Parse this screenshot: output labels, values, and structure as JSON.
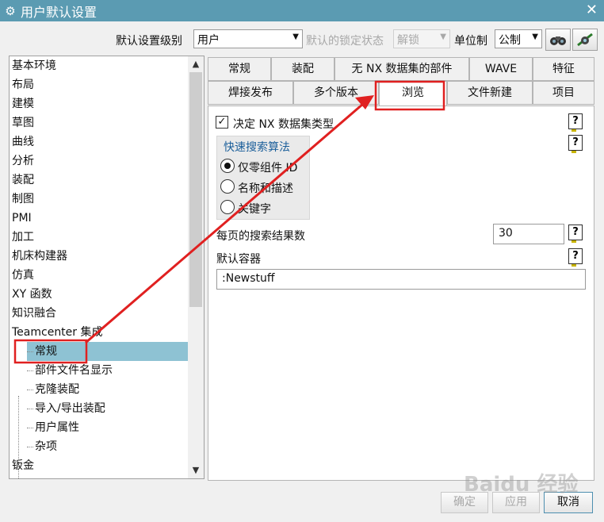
{
  "window": {
    "title": "用户默认设置"
  },
  "toolbar": {
    "level_label": "默认设置级别",
    "level_value": "用户",
    "lock_label": "默认的锁定状态",
    "lock_value": "解锁",
    "unit_label": "单位制",
    "unit_value": "公制",
    "btn1_icon": "binoculars-icon",
    "btn2_icon": "manager-icon"
  },
  "tree": {
    "items": [
      "基本环境",
      "布局",
      "建模",
      "草图",
      "曲线",
      "分析",
      "装配",
      "制图",
      "PMI",
      "加工",
      "机床构建器",
      "仿真",
      "XY 函数",
      "知识融合",
      "Teamcenter 集成"
    ],
    "children": [
      "常规",
      "部件文件名显示",
      "克隆装配",
      "导入/导出装配",
      "用户属性",
      "杂项"
    ],
    "after": "钣金",
    "selected": "常规"
  },
  "tabs": {
    "row1": [
      "常规",
      "装配",
      "无 NX 数据集的部件",
      "WAVE",
      "特征"
    ],
    "row2": [
      "焊接发布",
      "多个版本",
      "浏览",
      "文件新建",
      "项目"
    ],
    "active": "浏览"
  },
  "panel": {
    "checkbox_label": "决定 NX 数据集类型",
    "checkbox_checked": true,
    "group_title": "快速搜索算法",
    "radios": [
      "仅零组件 ID",
      "名称和描述",
      "关键字"
    ],
    "radio_selected": 0,
    "results_label": "每页的搜索结果数",
    "results_value": "30",
    "container_label": "默认容器",
    "container_value": ":Newstuff"
  },
  "buttons": {
    "ok": "确定",
    "apply": "应用",
    "cancel": "取消"
  },
  "watermark": "Baidu 经验",
  "colors": {
    "titlebar": "#5b9bb2",
    "selected": "#8ec2d3",
    "annotation": "#e02020"
  }
}
